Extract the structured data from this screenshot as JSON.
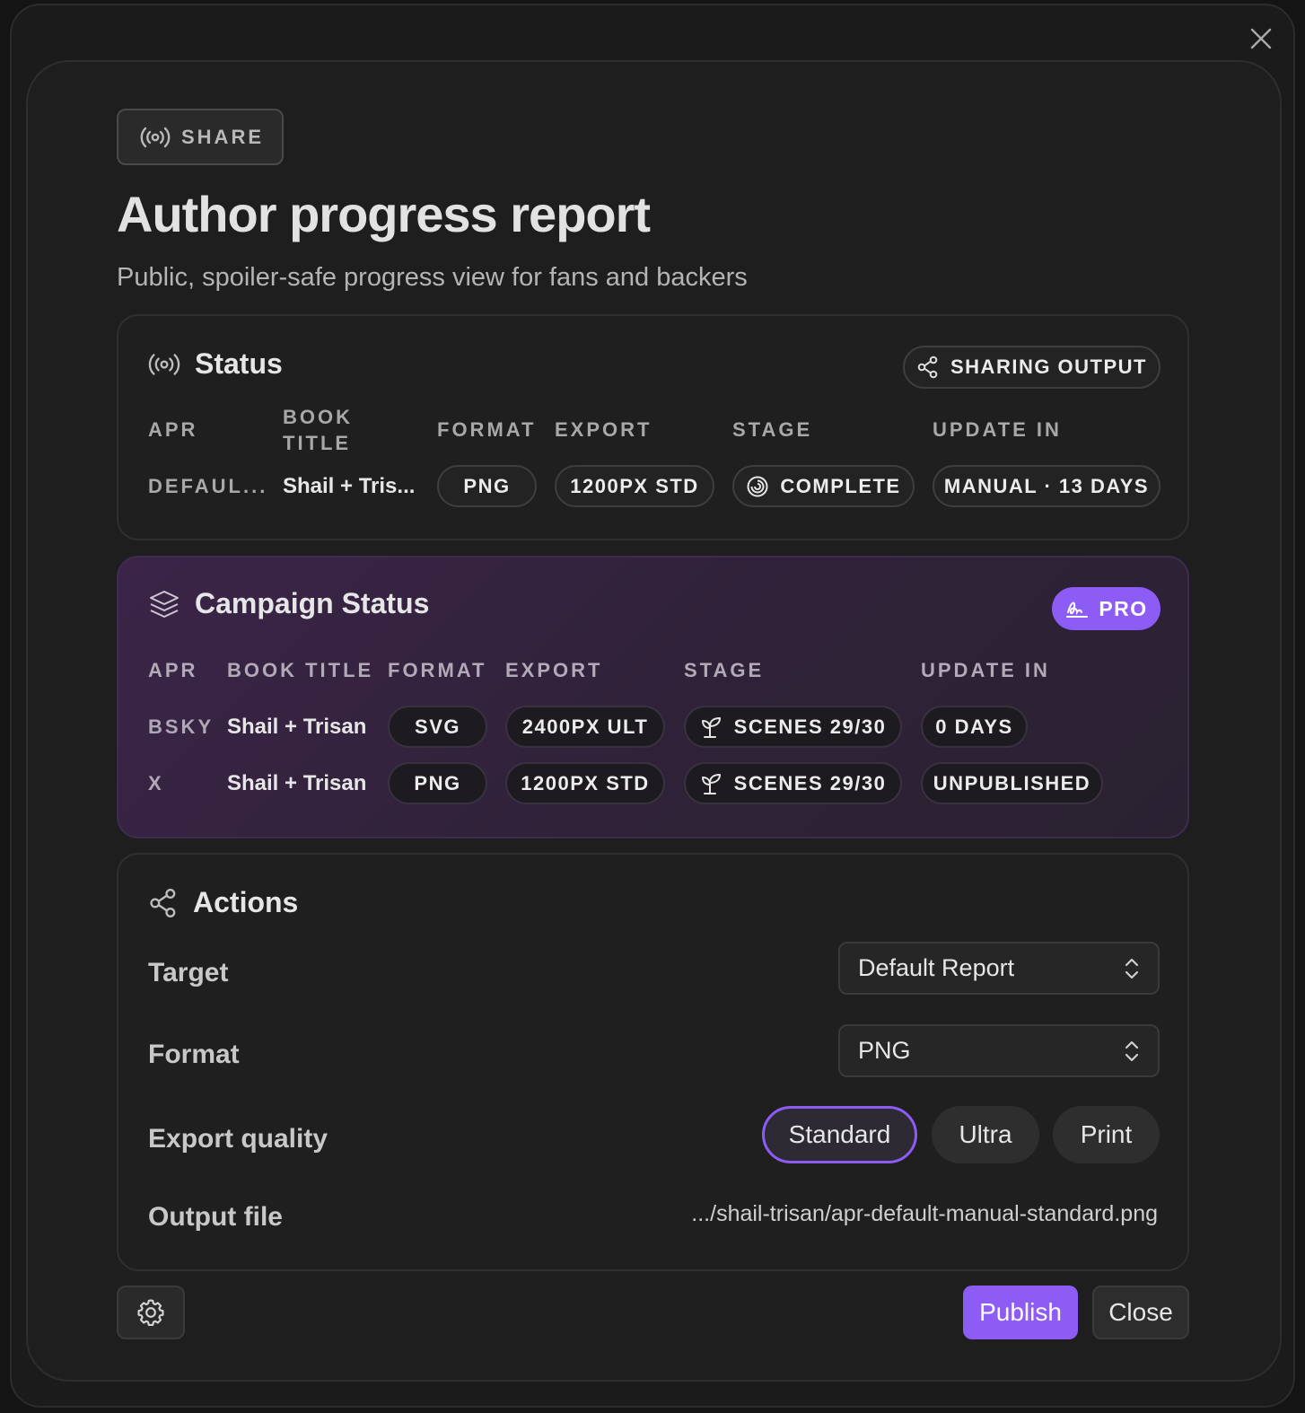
{
  "header": {
    "chip_label": "SHARE",
    "title": "Author progress report",
    "subtitle": "Public, spoiler-safe progress view for fans and backers"
  },
  "status": {
    "title": "Status",
    "badge": "SHARING OUTPUT",
    "columns": [
      "APR",
      "BOOK\nTITLE",
      "FORMAT",
      "EXPORT",
      "STAGE",
      "UPDATE IN"
    ],
    "row": {
      "apr": "DEFAUL...",
      "book_title": "Shail + Tris...",
      "format": "PNG",
      "export": "1200PX STD",
      "stage": "COMPLETE",
      "update_in": "MANUAL · 13 DAYS"
    }
  },
  "campaign": {
    "title": "Campaign Status",
    "badge": "PRO",
    "columns": [
      "APR",
      "BOOK TITLE",
      "FORMAT",
      "EXPORT",
      "STAGE",
      "UPDATE IN"
    ],
    "rows": [
      {
        "apr": "BSKY",
        "book_title": "Shail + Trisan",
        "format": "SVG",
        "export": "2400PX ULT",
        "stage": "SCENES 29/30",
        "update_in": "0 DAYS"
      },
      {
        "apr": "X",
        "book_title": "Shail + Trisan",
        "format": "PNG",
        "export": "1200PX STD",
        "stage": "SCENES 29/30",
        "update_in": "UNPUBLISHED"
      }
    ]
  },
  "actions": {
    "title": "Actions",
    "target_label": "Target",
    "target_value": "Default Report",
    "format_label": "Format",
    "format_value": "PNG",
    "quality_label": "Export quality",
    "quality_options": [
      "Standard",
      "Ultra",
      "Print"
    ],
    "quality_selected": "Standard",
    "output_label": "Output file",
    "output_value": ".../shail-trisan/apr-default-manual-standard.png"
  },
  "footer": {
    "publish_label": "Publish",
    "close_label": "Close"
  },
  "colors": {
    "accent": "#8d5cf5",
    "background": "#1e1e1e",
    "campaign_bg": "#3b2448"
  },
  "icons": [
    "close-icon",
    "broadcast-icon",
    "share-nodes-icon",
    "spiral-icon",
    "layers-icon",
    "signature-icon",
    "sprout-icon",
    "chevron-up-down-icon",
    "gear-icon"
  ]
}
